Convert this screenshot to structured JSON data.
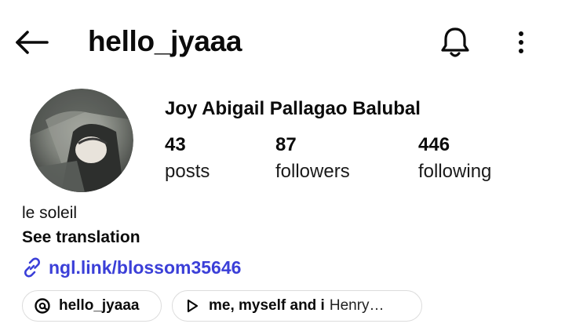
{
  "header": {
    "username": "hello_jyaaa",
    "back_icon": "arrow-left-icon",
    "bell_icon": "bell-icon",
    "more_icon": "more-vertical-icon"
  },
  "profile": {
    "avatar_icon": "profile-photo",
    "display_name": "Joy Abigail Pallagao Balubal",
    "stats": {
      "posts": {
        "value": "43",
        "label": "posts"
      },
      "followers": {
        "value": "87",
        "label": "followers"
      },
      "following": {
        "value": "446",
        "label": "following"
      }
    },
    "bio": "le soleil",
    "see_translation": "See translation",
    "link": {
      "icon": "link-icon",
      "text": "ngl.link/blossom35646"
    }
  },
  "chips": {
    "threads": {
      "icon": "threads-icon",
      "label": "hello_jyaaa"
    },
    "music": {
      "icon": "play-icon",
      "title": "me, myself and i",
      "artist": "Henry…"
    }
  },
  "colors": {
    "link": "#3b3fd8",
    "text": "#0b0b0b",
    "chip_border": "#dcdcdc",
    "background": "#ffffff"
  }
}
